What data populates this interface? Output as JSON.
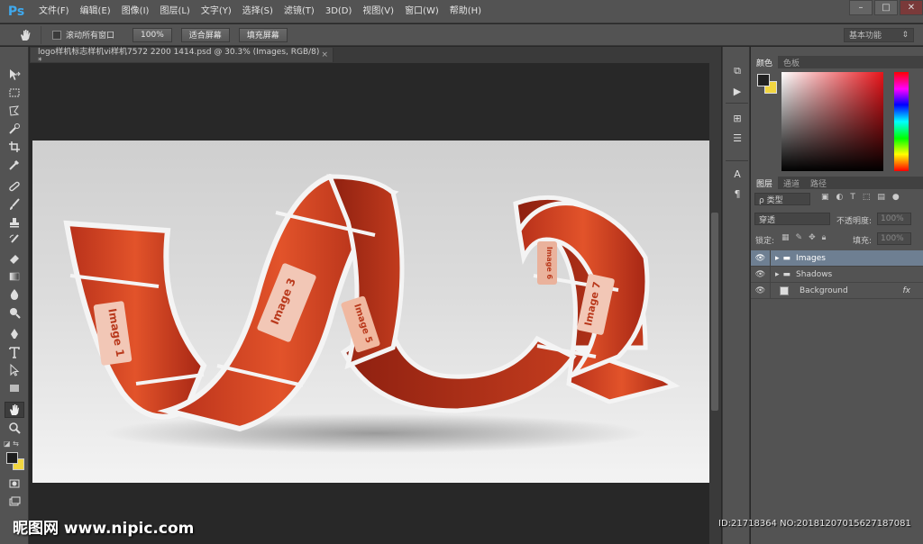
{
  "app": {
    "logo": "Ps"
  },
  "menu": [
    "文件(F)",
    "编辑(E)",
    "图像(I)",
    "图层(L)",
    "文字(Y)",
    "选择(S)",
    "滤镜(T)",
    "3D(D)",
    "视图(V)",
    "窗口(W)",
    "帮助(H)"
  ],
  "window_controls": {
    "minimize": "–",
    "restore": "□",
    "close": "✕"
  },
  "options": {
    "scroll_all_label": "滚动所有窗口",
    "zoom_100": "100%",
    "fit_screen": "适合屏幕",
    "fill_screen": "填充屏幕",
    "workspace": "基本功能"
  },
  "document": {
    "tab_title": "logo样机标志样机vi样机7572 2200 1414.psd @ 30.3% (Images, RGB/8) *",
    "close": "×",
    "ribbon_labels": [
      "Image 1",
      "Image 3",
      "Image 5",
      "Image 6",
      "Image 7"
    ]
  },
  "color_panel": {
    "tabs": [
      "颜色",
      "色板"
    ],
    "foreground": "#222222",
    "background": "#f2d640"
  },
  "layers_panel": {
    "tabs": [
      "图层",
      "通道",
      "路径"
    ],
    "filter_label": "ρ 类型",
    "blend_mode": "穿透",
    "opacity_label": "不透明度:",
    "opacity_value": "100%",
    "lock_label": "锁定:",
    "fill_label": "填充:",
    "fill_value": "100%",
    "layers": [
      {
        "name": "Images",
        "type": "group",
        "selected": true
      },
      {
        "name": "Shadows",
        "type": "group",
        "selected": false
      },
      {
        "name": "Background",
        "type": "layer",
        "selected": false,
        "fx": "fx"
      }
    ]
  },
  "watermark": {
    "site": "昵图网 www.nipic.com",
    "id_text": "ID:21718364 NO:20181207015627187081"
  }
}
